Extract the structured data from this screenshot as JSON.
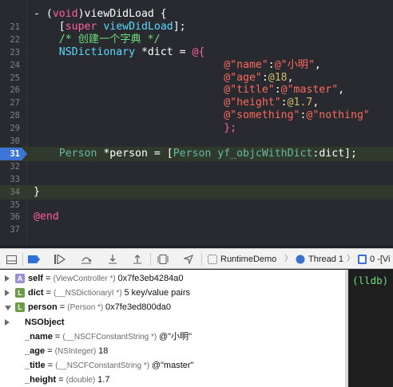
{
  "editor": {
    "lines": [
      {
        "num": "",
        "tokens": [
          {
            "t": "- (",
            "c": "white"
          },
          {
            "t": "void",
            "c": "kw"
          },
          {
            "t": ")viewDidLoad {",
            "c": "white"
          }
        ]
      },
      {
        "num": "21",
        "tokens": [
          {
            "t": "    [",
            "c": "white"
          },
          {
            "t": "super",
            "c": "kw"
          },
          {
            "t": " ",
            "c": "white"
          },
          {
            "t": "viewDidLoad",
            "c": "cls2"
          },
          {
            "t": "];",
            "c": "white"
          }
        ]
      },
      {
        "num": "22",
        "tokens": [
          {
            "t": "    ",
            "c": "white"
          },
          {
            "t": "/* 创建一个字典 */",
            "c": "cmt"
          }
        ]
      },
      {
        "num": "23",
        "tokens": [
          {
            "t": "    ",
            "c": "white"
          },
          {
            "t": "NSDictionary",
            "c": "cls2"
          },
          {
            "t": " *dict = ",
            "c": "white"
          },
          {
            "t": "@{",
            "c": "at"
          }
        ]
      },
      {
        "num": "24",
        "tokens": [
          {
            "t": "                              ",
            "c": "white"
          },
          {
            "t": "@\"name\"",
            "c": "str"
          },
          {
            "t": ":",
            "c": "white"
          },
          {
            "t": "@\"小明\"",
            "c": "str"
          },
          {
            "t": ",",
            "c": "white"
          }
        ]
      },
      {
        "num": "25",
        "tokens": [
          {
            "t": "                              ",
            "c": "white"
          },
          {
            "t": "@\"age\"",
            "c": "str"
          },
          {
            "t": ":",
            "c": "white"
          },
          {
            "t": "@18",
            "c": "num2"
          },
          {
            "t": ",",
            "c": "white"
          }
        ]
      },
      {
        "num": "26",
        "tokens": [
          {
            "t": "                              ",
            "c": "white"
          },
          {
            "t": "@\"title\"",
            "c": "str"
          },
          {
            "t": ":",
            "c": "white"
          },
          {
            "t": "@\"master\"",
            "c": "str"
          },
          {
            "t": ",",
            "c": "white"
          }
        ]
      },
      {
        "num": "27",
        "tokens": [
          {
            "t": "                              ",
            "c": "white"
          },
          {
            "t": "@\"height\"",
            "c": "str"
          },
          {
            "t": ":",
            "c": "white"
          },
          {
            "t": "@1.7",
            "c": "num2"
          },
          {
            "t": ",",
            "c": "white"
          }
        ]
      },
      {
        "num": "28",
        "tokens": [
          {
            "t": "                              ",
            "c": "white"
          },
          {
            "t": "@\"something\"",
            "c": "str"
          },
          {
            "t": ":",
            "c": "white"
          },
          {
            "t": "@\"nothing\"",
            "c": "str"
          }
        ]
      },
      {
        "num": "29",
        "tokens": [
          {
            "t": "                              ",
            "c": "white"
          },
          {
            "t": "};",
            "c": "at"
          }
        ]
      },
      {
        "num": "30",
        "tokens": []
      },
      {
        "num": "31",
        "tokens": [
          {
            "t": "    ",
            "c": "white"
          },
          {
            "t": "Person",
            "c": "tgreen"
          },
          {
            "t": " *person = [",
            "c": "white"
          },
          {
            "t": "Person",
            "c": "tgreen"
          },
          {
            "t": " ",
            "c": "white"
          },
          {
            "t": "yf_objcWithDict",
            "c": "tgreen"
          },
          {
            "t": ":dict];",
            "c": "white"
          }
        ],
        "breakpoint": true,
        "highlight": true
      },
      {
        "num": "32",
        "tokens": []
      },
      {
        "num": "33",
        "tokens": []
      },
      {
        "num": "34",
        "tokens": [
          {
            "t": "}",
            "c": "white"
          }
        ],
        "highlight": true
      },
      {
        "num": "35",
        "tokens": []
      },
      {
        "num": "36",
        "tokens": [
          {
            "t": "@end",
            "c": "kw"
          }
        ]
      },
      {
        "num": "37",
        "tokens": []
      }
    ]
  },
  "debugbar": {
    "scheme": "RuntimeDemo",
    "thread": "Thread 1",
    "frame": "0 -[Vi"
  },
  "variables": [
    {
      "indent": 0,
      "expanded": false,
      "badge": "A",
      "badge_color": "#9b8fd8",
      "name": "self",
      "type": "(ViewController *)",
      "value": "0x7fe3eb4284a0"
    },
    {
      "indent": 0,
      "expanded": false,
      "badge": "L",
      "badge_color": "#6c9a45",
      "name": "dict",
      "type": "(__NSDictionaryI *)",
      "value": "5 key/value pairs"
    },
    {
      "indent": 0,
      "expanded": true,
      "badge": "L",
      "badge_color": "#6c9a45",
      "name": "person",
      "type": "(Person *)",
      "value": "0x7fe3ed800da0"
    },
    {
      "indent": 1,
      "expanded": false,
      "badge": "",
      "badge_color": "",
      "name": "NSObject",
      "type": "",
      "value": ""
    },
    {
      "indent": 1,
      "expanded": false,
      "badge": "",
      "badge_color": "",
      "name": "_name",
      "type": "(__NSCFConstantString *)",
      "value": "@\"小明\""
    },
    {
      "indent": 1,
      "expanded": false,
      "badge": "",
      "badge_color": "",
      "name": "_age",
      "type": "(NSInteger)",
      "value": "18"
    },
    {
      "indent": 1,
      "expanded": false,
      "badge": "",
      "badge_color": "",
      "name": "_title",
      "type": "(__NSCFConstantString *)",
      "value": "@\"master\""
    },
    {
      "indent": 1,
      "expanded": false,
      "badge": "",
      "badge_color": "",
      "name": "_height",
      "type": "(double)",
      "value": "1.7"
    }
  ],
  "console": {
    "prompt": "(lldb)"
  }
}
